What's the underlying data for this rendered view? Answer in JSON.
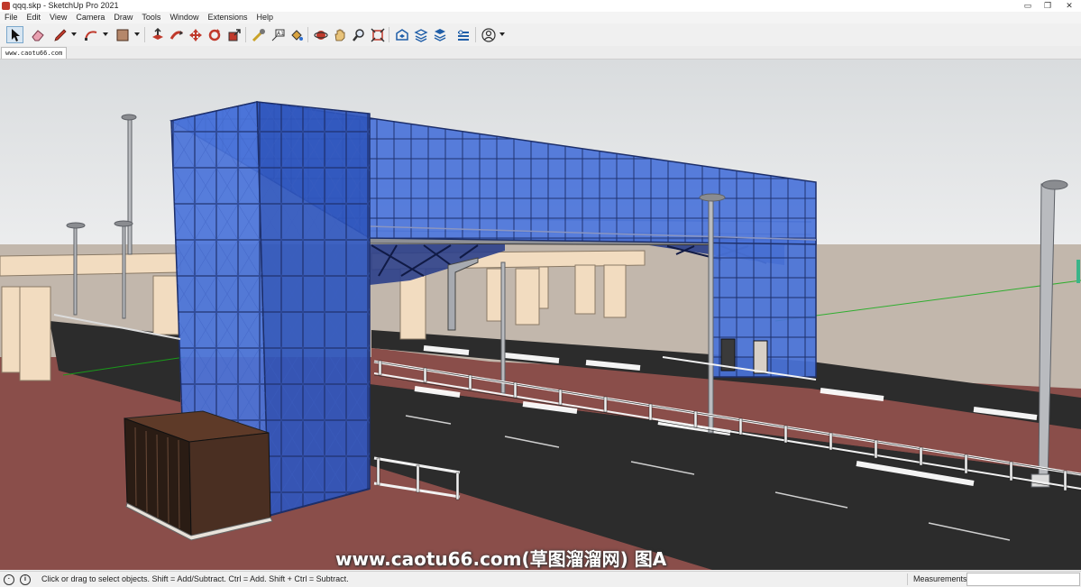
{
  "window": {
    "title": "qqq.skp - SketchUp Pro 2021",
    "controls": {
      "minimize": "▭",
      "restore": "❐",
      "close": "✕"
    }
  },
  "menu": [
    "File",
    "Edit",
    "View",
    "Camera",
    "Draw",
    "Tools",
    "Window",
    "Extensions",
    "Help"
  ],
  "toolbar": {
    "tools": [
      {
        "name": "select-tool",
        "icon": "arrow-cursor-icon",
        "selected": true
      },
      {
        "name": "eraser-tool",
        "icon": "eraser-icon"
      },
      {
        "name": "line-tool",
        "icon": "pencil-icon"
      },
      {
        "name": "arc-tool",
        "icon": "arc-icon"
      },
      {
        "name": "shape-tool",
        "icon": "rectangle-icon"
      },
      {
        "name": "push-pull-tool",
        "icon": "push-pull-icon"
      },
      {
        "name": "follow-me-tool",
        "icon": "follow-me-icon"
      },
      {
        "name": "move-tool",
        "icon": "move-icon"
      },
      {
        "name": "rotate-tool",
        "icon": "rotate-icon"
      },
      {
        "name": "scale-tool",
        "icon": "scale-icon"
      },
      {
        "name": "tape-measure-tool",
        "icon": "tape-measure-icon"
      },
      {
        "name": "text-tool",
        "icon": "text-icon"
      },
      {
        "name": "paint-bucket-tool",
        "icon": "paint-bucket-icon"
      },
      {
        "name": "orbit-tool",
        "icon": "orbit-icon"
      },
      {
        "name": "pan-tool",
        "icon": "hand-icon"
      },
      {
        "name": "zoom-tool",
        "icon": "magnifier-icon"
      },
      {
        "name": "zoom-extents-tool",
        "icon": "zoom-extents-icon"
      },
      {
        "name": "3d-warehouse",
        "icon": "warehouse-icon"
      },
      {
        "name": "extension-warehouse",
        "icon": "extension-warehouse-icon"
      },
      {
        "name": "layout-send",
        "icon": "layout-icon"
      },
      {
        "name": "extension-manager",
        "icon": "extension-manager-icon"
      },
      {
        "name": "account",
        "icon": "user-icon"
      }
    ]
  },
  "scene_tab": "www.caotu66.com",
  "viewport": {
    "watermark": "www.caotu66.com(草图溜溜网) 图A",
    "colors": {
      "sky_top": "#d9dcde",
      "sky_bottom": "#ecedee",
      "ground": "#c2b7ac",
      "road": "#2c2c2c",
      "sidewalk": "#8a4e4a",
      "glass": "#4a73d9",
      "glass_dark": "#2f56bd",
      "concrete": "#f2dcc0"
    }
  },
  "status": {
    "hint": "Click or drag to select objects. Shift = Add/Subtract. Ctrl = Add. Shift + Ctrl = Subtract.",
    "measurements_label": "Measurements",
    "measurements_value": ""
  }
}
